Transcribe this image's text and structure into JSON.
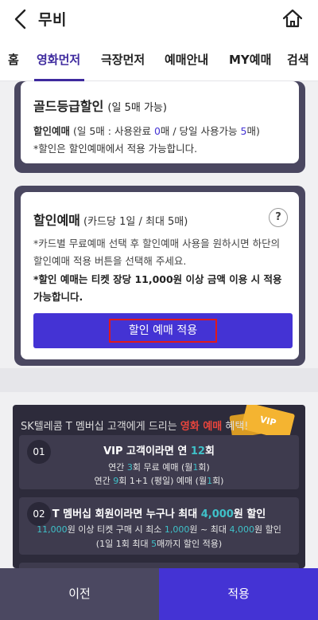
{
  "header": {
    "title": "무비"
  },
  "tabs": [
    {
      "label": "홈"
    },
    {
      "label": "영화먼저"
    },
    {
      "label": "극장먼저"
    },
    {
      "label": "예매안내"
    },
    {
      "label": "MY예매"
    },
    {
      "label": "검색"
    }
  ],
  "gold": {
    "title": "골드등급할인",
    "title_sub": "(일 5매 가능)",
    "line1_a": "할인예매",
    "line1_b": " (일 5매 : 사용완료 ",
    "line1_used": "0",
    "line1_c": "매 / 당일 사용가능 ",
    "line1_avail": "5",
    "line1_d": "매)",
    "line2": "*할인은 할인예매에서 적용 가능합니다."
  },
  "discount": {
    "title": "할인예매",
    "title_sub": " (카드당 1일 / 최대 5매)",
    "help": "?",
    "text1": "*카드별 무료예매 선택 후 할인예매 사용을 원하시면 하단의 할인예매 적용 버튼을 선택해 주세요.",
    "text2": "*할인 예매는 티켓 장당 11,000원 이상 금액 이용 시 적용 가능합니다.",
    "apply_label": "할인 예매 적용"
  },
  "promo": {
    "head_a": "SK텔레콤 T 멤버십 고객에게 드리는 ",
    "head_hl": "영화 예매",
    "head_b": " 혜택!",
    "ticket_label": "VIP",
    "benefits": [
      {
        "num": "01",
        "title_a": "VIP 고객이라면 연 ",
        "title_hl": "12",
        "title_b": "회",
        "line1_a": "연간 ",
        "line1_hl": "3",
        "line1_b": "회 무료 예매 (월",
        "line1_hl2": "1",
        "line1_c": "회)",
        "line2_a": "연간 ",
        "line2_hl": "9",
        "line2_b": "회 1+1 (평일) 예매 (월",
        "line2_hl2": "1",
        "line2_c": "회)"
      },
      {
        "num": "02",
        "title_a": "T 멤버십 회원이라면 누구나 최대 ",
        "title_hl": "4,000",
        "title_b": "원 할인",
        "line1_hl": "11,000",
        "line1_a": "원 이상 티켓 구매 시 최소 ",
        "line1_hl2": "1,000",
        "line1_b": "원 ~ 최대 ",
        "line1_hl3": "4,000",
        "line1_c": "원 할인",
        "line2_a": "(1일 1회 최대 ",
        "line2_hl": "5",
        "line2_b": "매까지 할인 적용)"
      }
    ]
  },
  "bottom": {
    "prev_label": "이전",
    "apply_label": "적용"
  },
  "colors": {
    "accent": "#4433d4",
    "panel": "#4a4760",
    "highlight_red": "#e0191b",
    "teal": "#3fc1c9"
  }
}
